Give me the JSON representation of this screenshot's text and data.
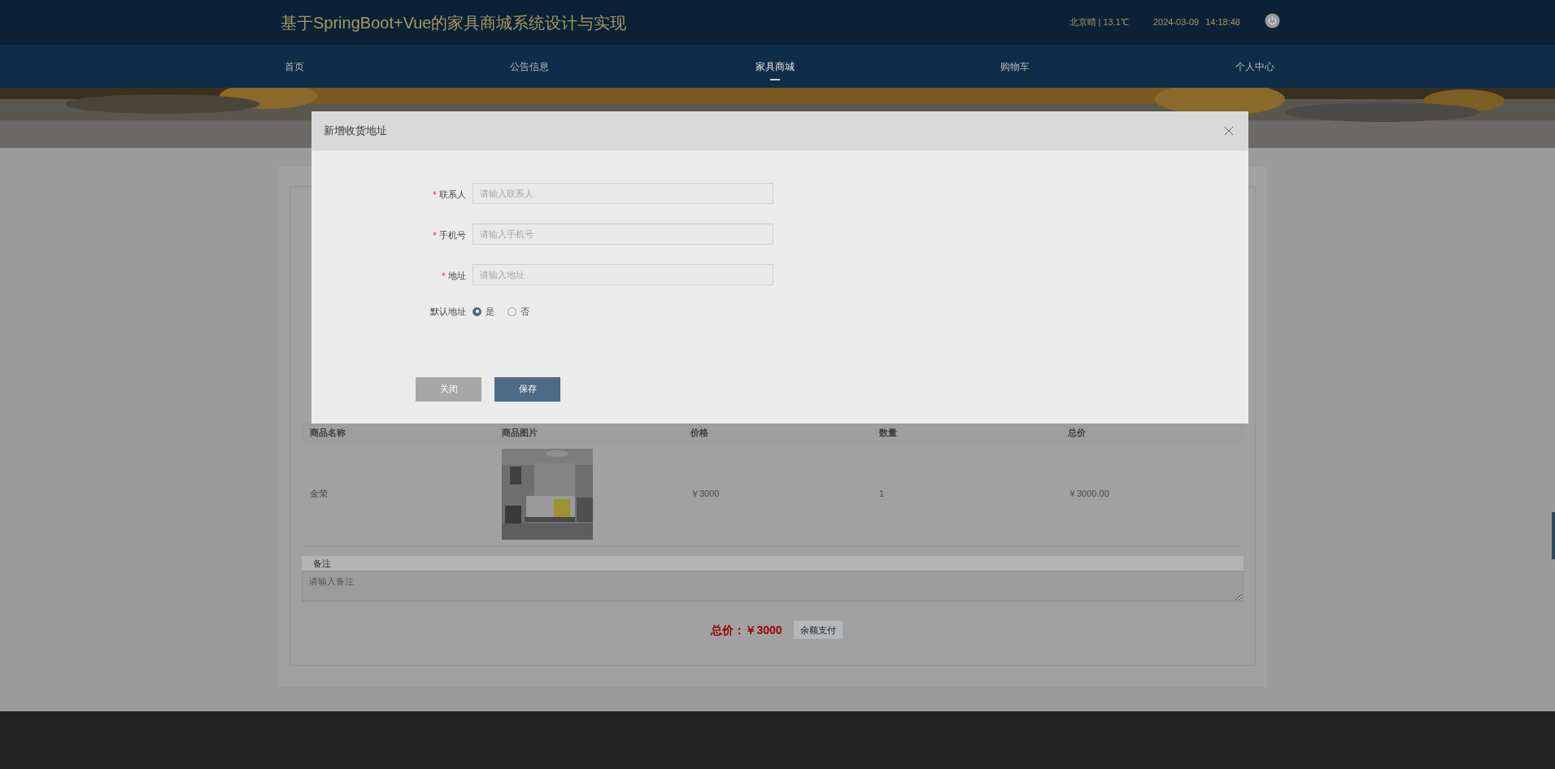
{
  "header": {
    "title": "基于SpringBoot+Vue的家具商城系统设计与实现",
    "weather": "北京晴 | 13.1℃",
    "date": "2024-03-09",
    "time": "14:18:48"
  },
  "nav": [
    {
      "label": "首页",
      "selected": false
    },
    {
      "label": "公告信息",
      "selected": false
    },
    {
      "label": "家具商城",
      "selected": true
    },
    {
      "label": "购物车",
      "selected": false
    },
    {
      "label": "个人中心",
      "selected": false
    }
  ],
  "order": {
    "items_table": {
      "columns": [
        "商品名称",
        "商品图片",
        "价格",
        "数量",
        "总价"
      ],
      "rows": [
        {
          "name": "金荣",
          "price": "￥3000",
          "quantity": "1",
          "total": "￥3000.00"
        }
      ]
    },
    "note_label": "备注",
    "note_placeholder": "请输入备注",
    "total": "总价：￥3000",
    "pay_button": "余额支付"
  },
  "dialog": {
    "title": "新增收货地址",
    "fields": [
      {
        "label": "联系人",
        "required": true,
        "placeholder": "请输入联系人"
      },
      {
        "label": "手机号",
        "required": true,
        "placeholder": "请输入手机号"
      },
      {
        "label": "地址",
        "required": true,
        "placeholder": "请输入地址"
      }
    ],
    "default_address": {
      "label": "默认地址",
      "options": [
        {
          "label": "是",
          "selected": true
        },
        {
          "label": "否",
          "selected": false
        }
      ]
    },
    "buttons": [
      {
        "label": "关闭",
        "kind": "secondary"
      },
      {
        "label": "保存",
        "kind": "primary"
      }
    ]
  }
}
